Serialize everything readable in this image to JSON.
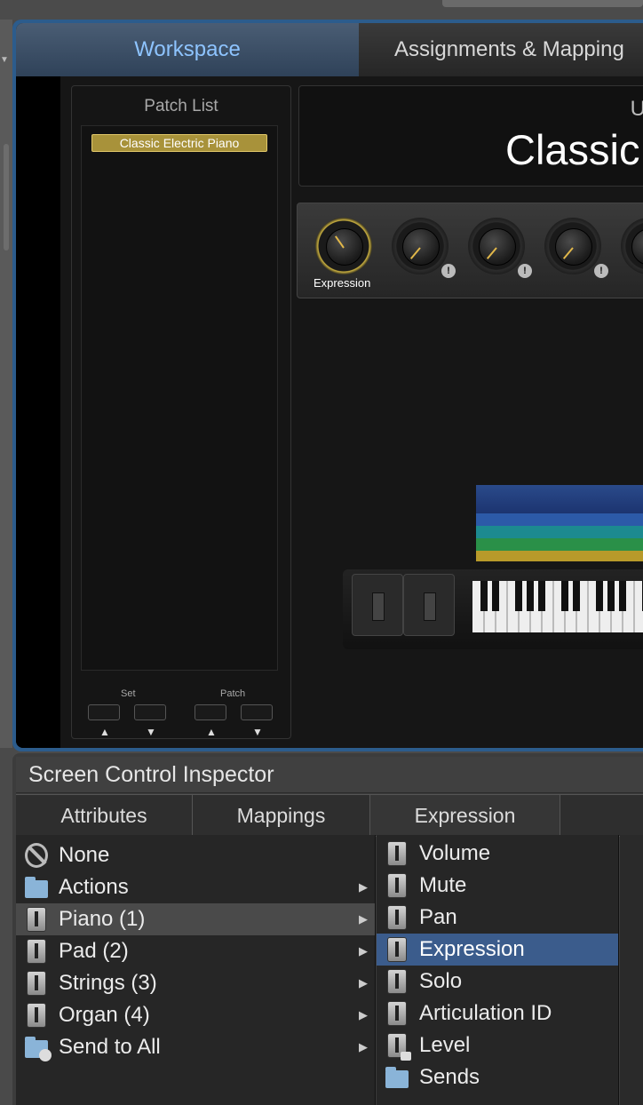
{
  "workspace_tabs": {
    "workspace": "Workspace",
    "assignments": "Assignments & Mapping"
  },
  "patch_list": {
    "title": "Patch List",
    "items": [
      "Classic Electric Piano"
    ],
    "set_label": "Set",
    "patch_label": "Patch"
  },
  "patch_header": {
    "top_text": "Ur",
    "name": "Classic"
  },
  "knobs": {
    "first_label": "Expression"
  },
  "inspector": {
    "title": "Screen Control Inspector",
    "tabs": [
      "Attributes",
      "Mappings",
      "Expression"
    ],
    "left_items": [
      {
        "label": "None",
        "icon": "none-icon"
      },
      {
        "label": "Actions",
        "icon": "folder-icon",
        "has_submenu": true
      },
      {
        "label": "Piano (1)",
        "icon": "fader-icon",
        "has_submenu": true,
        "selected": true
      },
      {
        "label": "Pad (2)",
        "icon": "fader-icon",
        "has_submenu": true
      },
      {
        "label": "Strings (3)",
        "icon": "fader-icon",
        "has_submenu": true
      },
      {
        "label": "Organ (4)",
        "icon": "fader-icon",
        "has_submenu": true
      },
      {
        "label": "Send to All",
        "icon": "send-folder-icon",
        "has_submenu": true
      }
    ],
    "right_items": [
      {
        "label": "Volume",
        "icon": "fader-icon"
      },
      {
        "label": "Mute",
        "icon": "fader-icon"
      },
      {
        "label": "Pan",
        "icon": "fader-icon"
      },
      {
        "label": "Expression",
        "icon": "fader-icon",
        "selected": true
      },
      {
        "label": "Solo",
        "icon": "fader-icon"
      },
      {
        "label": "Articulation ID",
        "icon": "fader-icon"
      },
      {
        "label": "Level",
        "icon": "locked-fader-icon"
      },
      {
        "label": "Sends",
        "icon": "folder-icon"
      }
    ]
  },
  "colors": {
    "accent_blue": "#3b5c8c",
    "workspace_tab_text": "#8ec4ff",
    "patch_selected": "#a8923a",
    "knob_ring_active": "#ccb240"
  }
}
